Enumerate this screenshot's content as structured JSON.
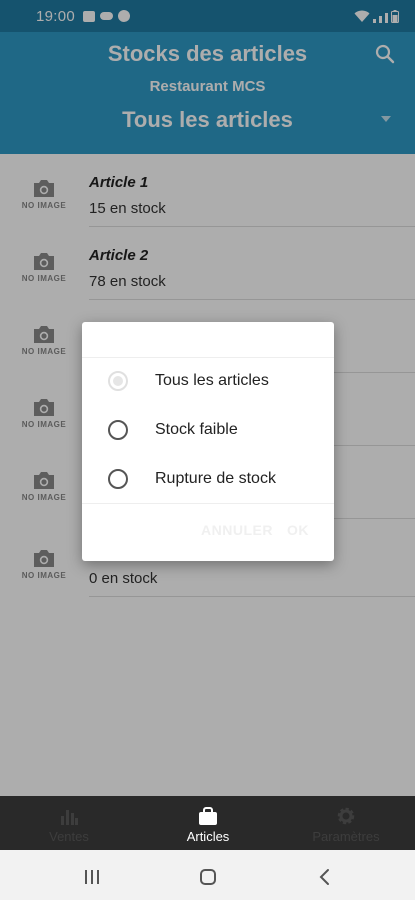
{
  "status_bar": {
    "time": "19:00"
  },
  "header": {
    "title": "Stocks des articles",
    "subtitle": "Restaurant MCS",
    "filter_selected": "Tous les articles"
  },
  "articles": [
    {
      "name": "Article 1",
      "stock": "15 en stock",
      "thumb_text": "NO IMAGE"
    },
    {
      "name": "Article 2",
      "stock": "78 en stock",
      "thumb_text": "NO IMAGE"
    },
    {
      "name": "",
      "stock": "",
      "thumb_text": "NO IMAGE"
    },
    {
      "name": "",
      "stock": "",
      "thumb_text": "NO IMAGE"
    },
    {
      "name": "",
      "stock": "",
      "thumb_text": "NO IMAGE"
    },
    {
      "name": "",
      "stock": "0 en stock",
      "thumb_text": "NO IMAGE"
    }
  ],
  "dialog": {
    "options": [
      {
        "label": "Tous les articles",
        "selected": true
      },
      {
        "label": "Stock faible",
        "selected": false
      },
      {
        "label": "Rupture de stock",
        "selected": false
      }
    ],
    "cancel_label": "ANNULER",
    "ok_label": "OK"
  },
  "bottom_nav": {
    "items": [
      {
        "label": "Ventes",
        "icon": "bar-chart-icon",
        "active": false
      },
      {
        "label": "Articles",
        "icon": "bag-icon",
        "active": true
      },
      {
        "label": "Paramètres",
        "icon": "gear-icon",
        "active": false
      }
    ]
  },
  "colors": {
    "status_bar": "#1f7ba3",
    "header": "#2f9ac6",
    "bottom_nav": "#292929"
  }
}
